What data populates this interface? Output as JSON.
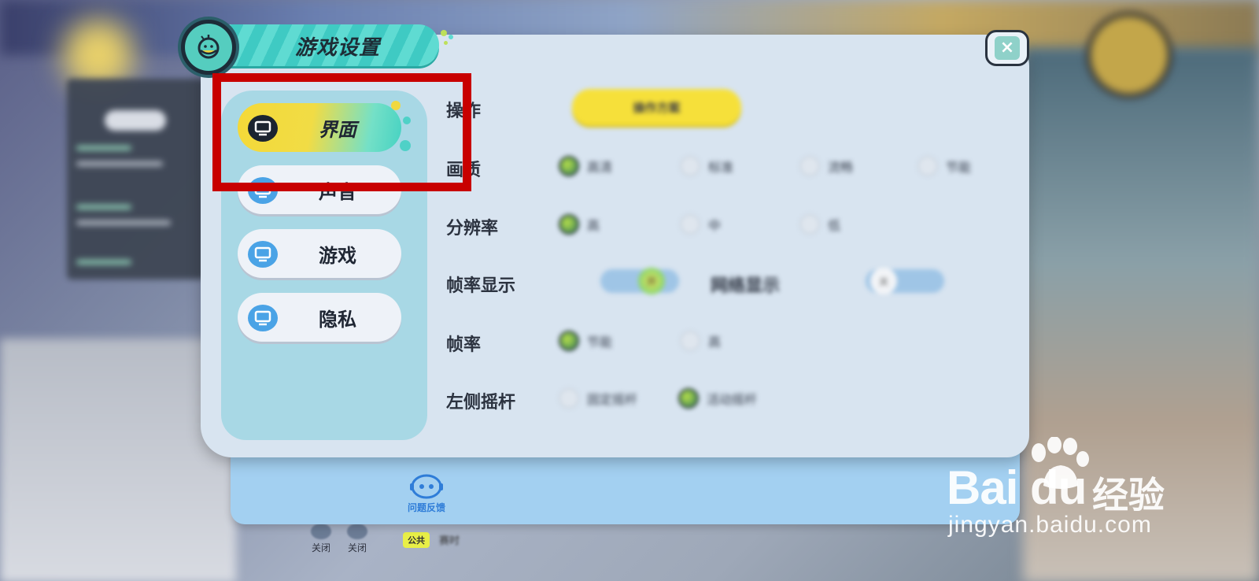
{
  "dialog": {
    "title": "游戏设置",
    "close_symbol": "×"
  },
  "tabs": [
    {
      "label": "界面",
      "icon": "monitor-icon",
      "active": true
    },
    {
      "label": "声音",
      "icon": "monitor-icon",
      "active": false
    },
    {
      "label": "游戏",
      "icon": "monitor-icon",
      "active": false
    },
    {
      "label": "隐私",
      "icon": "monitor-icon",
      "active": false
    }
  ],
  "settings": {
    "operation": {
      "label": "操作",
      "button_label": "操作方案"
    },
    "quality": {
      "label": "画质",
      "options": [
        "高清",
        "标准",
        "流畅",
        "节能"
      ],
      "selected": "高清"
    },
    "resolution": {
      "label": "分辨率",
      "options": [
        "高",
        "中",
        "低"
      ],
      "selected": "高"
    },
    "fps_display": {
      "label": "帧率显示",
      "state": "开"
    },
    "latency_display": {
      "label": "网络显示",
      "state": "关"
    },
    "fps": {
      "label": "帧率",
      "options": [
        "节能",
        "高"
      ],
      "selected": "节能"
    },
    "left_joystick": {
      "label": "左侧摇杆",
      "options": [
        "固定摇杆",
        "活动摇杆"
      ],
      "selected": "活动摇杆"
    }
  },
  "footer": {
    "feedback_label": "问题反馈"
  },
  "background_hud": {
    "bottom_icons": [
      {
        "label": "关闭",
        "icon": "mic-icon"
      },
      {
        "label": "关闭",
        "icon": "speaker-icon"
      }
    ],
    "channel_badge": "公共",
    "channel_text": "赛时"
  },
  "watermark": {
    "brand": "Bai du",
    "brand_cn": "经验",
    "url": "jingyan.baidu.com"
  },
  "colors": {
    "highlight_box": "#c80000",
    "active_tab_start": "#f4d938",
    "active_tab_end": "#46d2c2",
    "title_bar": "#3fcac3",
    "modal_bg": "#d8e4f0",
    "tray_bg": "#a3d0f1"
  }
}
